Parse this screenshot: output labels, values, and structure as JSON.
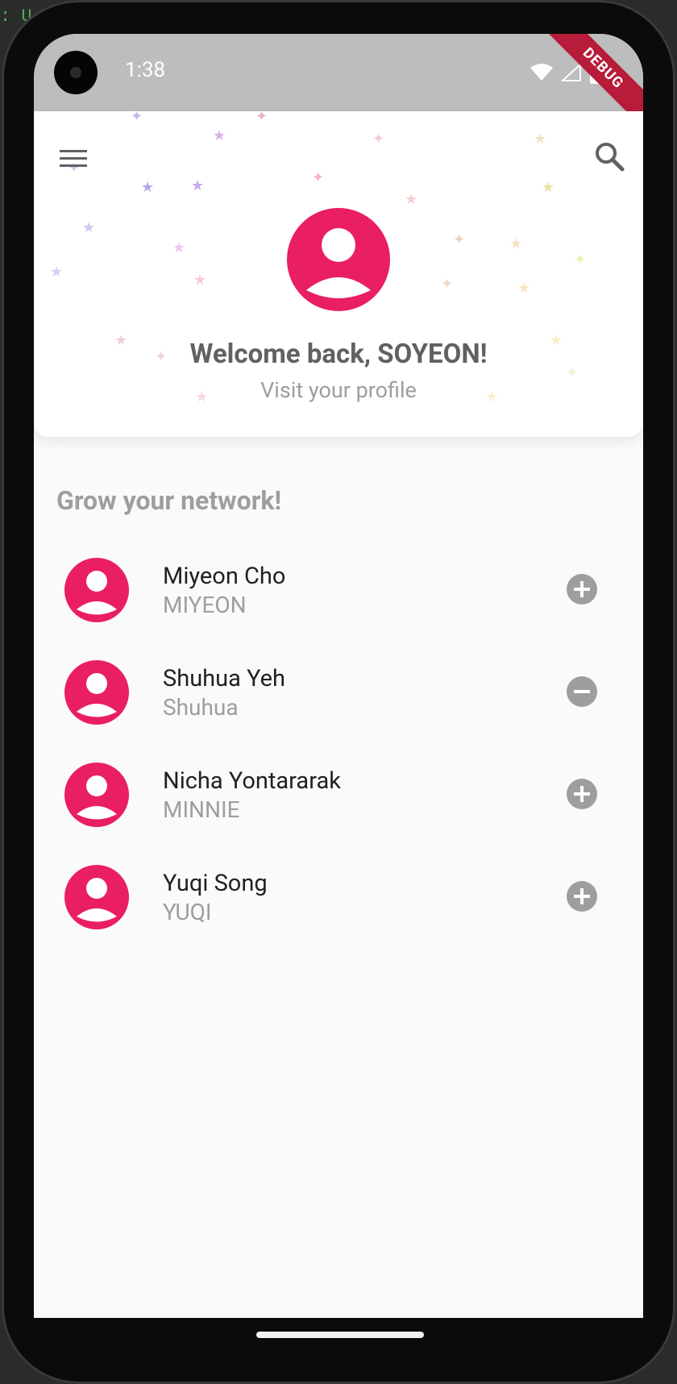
{
  "ide": {
    "fragment": ": U"
  },
  "status_bar": {
    "time": "1:38",
    "debug_label": "DEBUG"
  },
  "header": {
    "menu_icon": "menu-icon",
    "search_icon": "search-icon",
    "welcome": "Welcome back, SOYEON!",
    "visit_profile": "Visit your profile"
  },
  "section_title": "Grow your network!",
  "users": [
    {
      "name": "Miyeon Cho",
      "handle": "MIYEON",
      "action": "add"
    },
    {
      "name": "Shuhua Yeh",
      "handle": "Shuhua",
      "action": "remove"
    },
    {
      "name": "Nicha Yontararak",
      "handle": "MINNIE",
      "action": "add"
    },
    {
      "name": "Yuqi Song",
      "handle": "YUQI",
      "action": "add"
    }
  ],
  "colors": {
    "accent": "#e91e63",
    "status_bar": "#bdbdbd",
    "action_icon": "#9e9e9e"
  }
}
